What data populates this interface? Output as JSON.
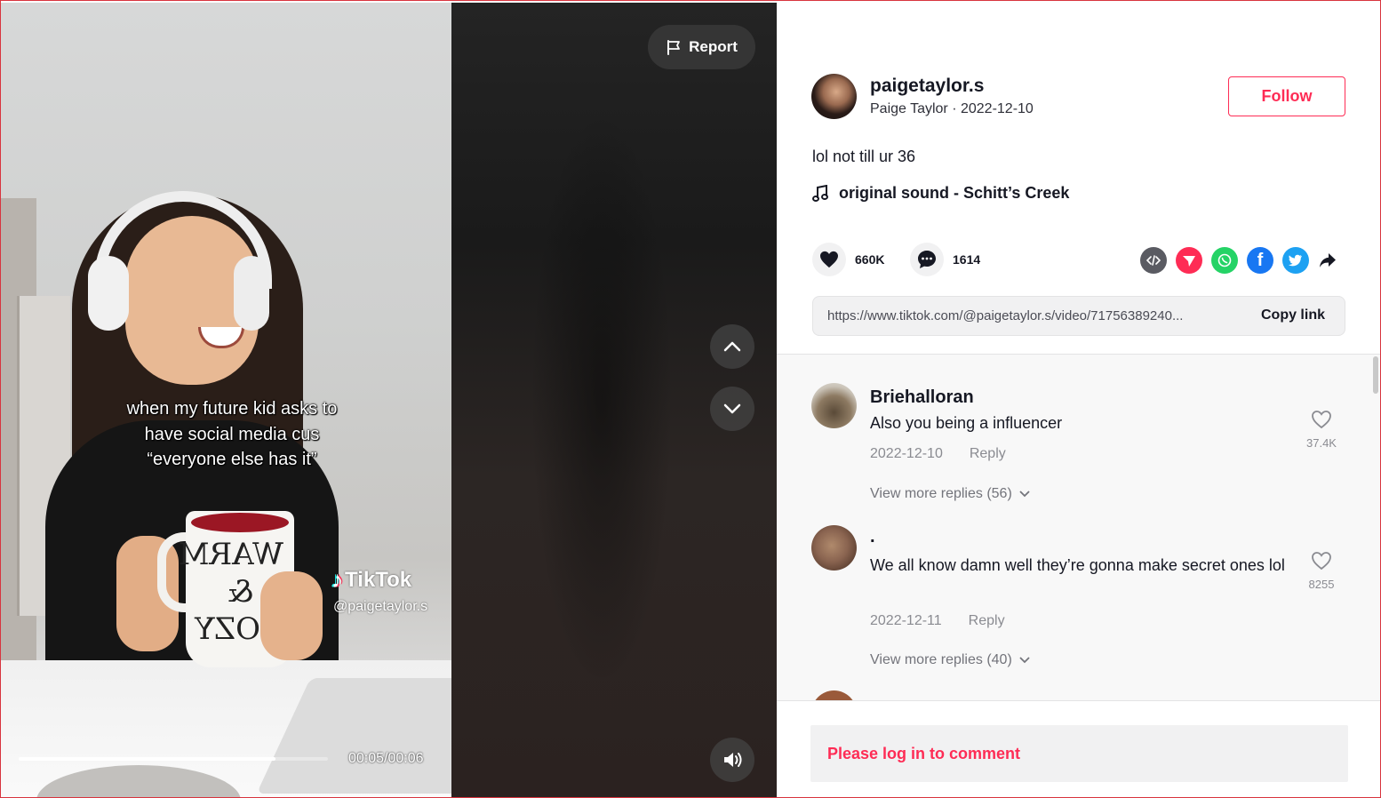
{
  "video": {
    "caption_lines": [
      "when my future kid asks to",
      "have social media cus",
      "“everyone else has it”"
    ],
    "watermark_brand": "TikTok",
    "watermark_user": "@paigetaylor.s",
    "mug_text": "WARM & COZY",
    "time": "00:05/00:06",
    "progress": 0.83
  },
  "controls": {
    "report_label": "Report",
    "report_icon": "flag-icon",
    "prev_icon": "chevron-up-icon",
    "next_icon": "chevron-down-icon",
    "volume_icon": "volume-icon"
  },
  "author": {
    "username": "paigetaylor.s",
    "display_name": "Paige Taylor",
    "date": "2022-12-10",
    "separator": " · ",
    "follow_label": "Follow"
  },
  "post": {
    "description": "lol not till ur 36",
    "music": "original sound - Schitt’s Creek"
  },
  "stats": {
    "likes": "660K",
    "comments": "1614"
  },
  "share": {
    "icons": [
      "embed-icon",
      "send-icon",
      "whatsapp-icon",
      "facebook-icon",
      "twitter-icon",
      "share-arrow-icon"
    ]
  },
  "link": {
    "url": "https://www.tiktok.com/@paigetaylor.s/video/71756389240...",
    "copy_label": "Copy link"
  },
  "comments": [
    {
      "user": "Briehalloran",
      "text": "Also you being a influencer",
      "date": "2022-12-10",
      "reply_label": "Reply",
      "likes": "37.4K",
      "more_replies": "View more replies (56)"
    },
    {
      "user": ".",
      "text": "We all know damn well they’re gonna make secret ones lol",
      "date": "2022-12-11",
      "reply_label": "Reply",
      "likes": "8255",
      "more_replies": "View more replies (40)"
    }
  ],
  "login_prompt": "Please log in to comment",
  "colors": {
    "brand_red": "#fe2c55",
    "dark_text": "#161823",
    "muted_text": "#8a8b91"
  }
}
